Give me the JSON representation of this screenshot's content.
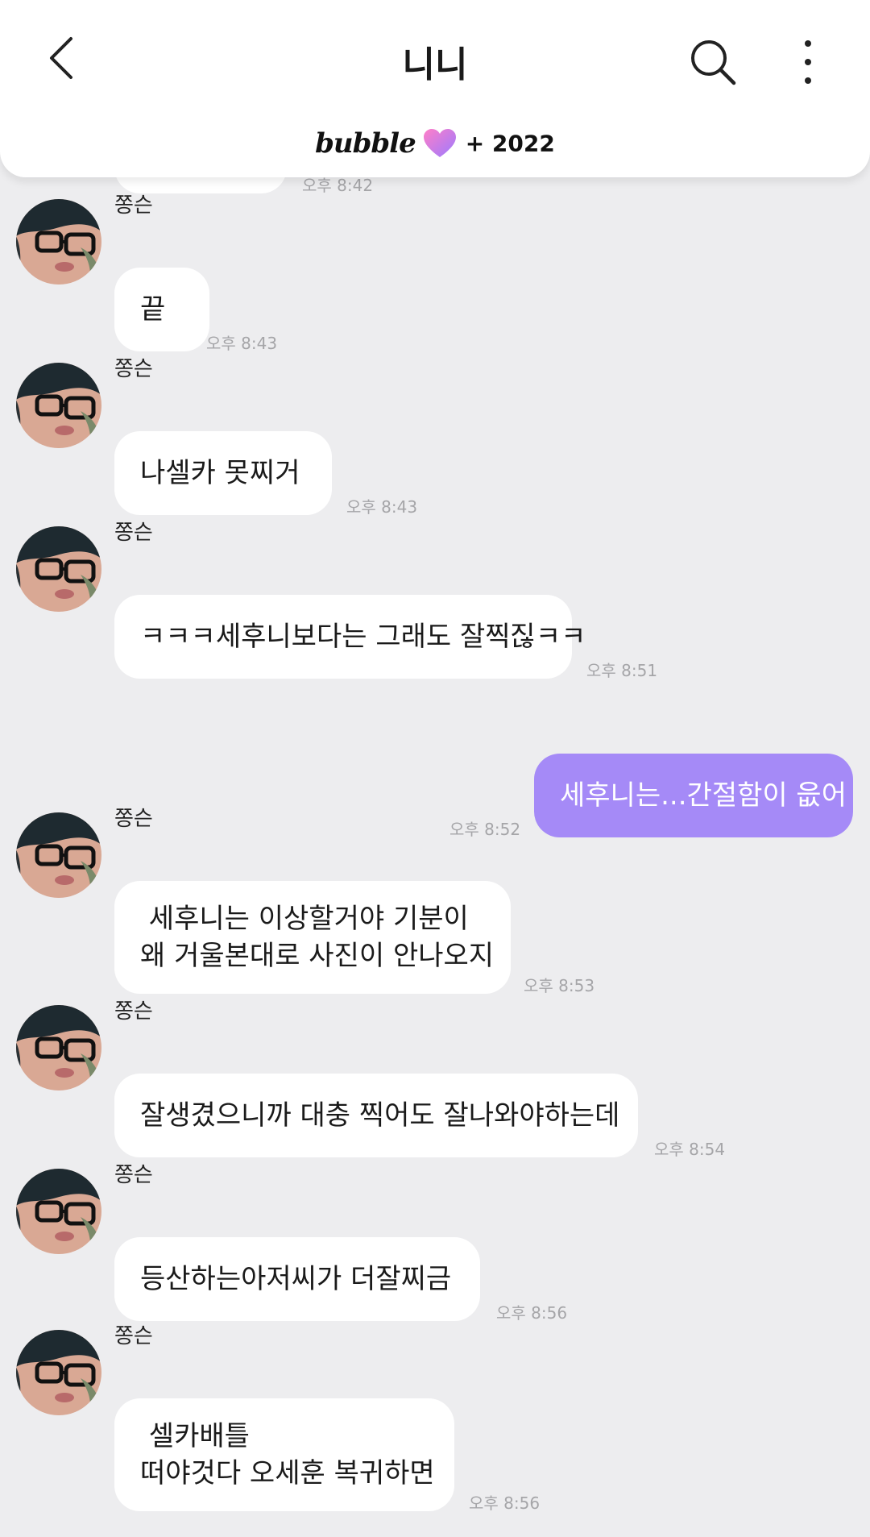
{
  "header": {
    "title": "니니",
    "brand": "bubble",
    "days": "+ 2022"
  },
  "chat": {
    "sender": "쫑슨",
    "partial_time": "오후 8:42",
    "messages": [
      {
        "text": "끝",
        "time": "오후 8:43"
      },
      {
        "text": "나셀카 못찌거",
        "time": "오후 8:43"
      },
      {
        "text": "ㅋㅋㅋ세후니보다는 그래도 잘찍짆ㅋㅋ",
        "time": "오후 8:51"
      },
      {
        "text": "세후니는...간절함이 읎어",
        "time": "오후 8:52",
        "mine": true
      },
      {
        "text": " 세후니는 이상할거야 기분이\n왜 거울본대로 사진이 안나오지",
        "time": "오후 8:53"
      },
      {
        "text": "잘생겼으니까 대충 찍어도 잘나와야하는데",
        "time": "오후 8:54"
      },
      {
        "text": "등산하는아저씨가 더잘찌금",
        "time": "오후 8:56"
      },
      {
        "text": " 셀카배틀\n떠야것다 오세훈 복귀하면",
        "time": "오후 8:56"
      }
    ]
  },
  "colors": {
    "background": "#ededef",
    "my_bubble": "#a58af7",
    "their_bubble": "#ffffff",
    "timestamp": "#a5a5a8"
  },
  "icons": [
    "back-arrow-icon",
    "search-icon",
    "more-vertical-icon",
    "heart-icon",
    "avatar"
  ]
}
